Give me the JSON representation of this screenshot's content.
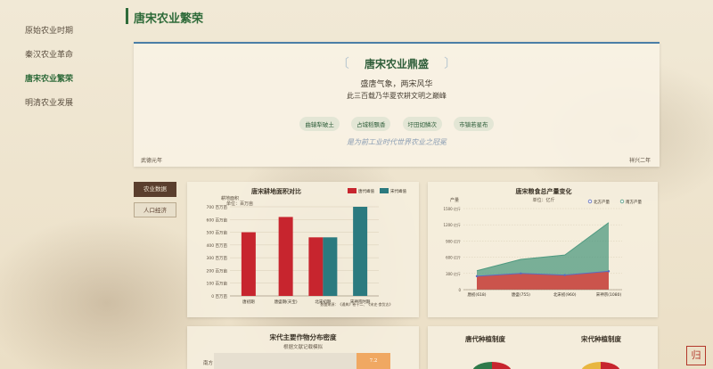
{
  "sidebar": {
    "items": [
      {
        "label": "原始农业时期"
      },
      {
        "label": "秦汉农业革命"
      },
      {
        "label": "唐宋农业繁荣"
      },
      {
        "label": "明清农业发展"
      }
    ]
  },
  "page": {
    "title": "唐宋农业繁荣"
  },
  "hero": {
    "title": "唐宋农业鼎盛",
    "line1": "盛唐气象，两宋风华",
    "line2": "此三百载乃华夏农耕文明之巅峰",
    "tags": [
      "曲辕犁破土",
      "占城稻飘香",
      "圩田如鳞次",
      "市镇若星布"
    ],
    "quote": "是为前工业时代世界农业之冠冕",
    "left_note": "武德元年",
    "right_note": "祥兴二年"
  },
  "buttons": {
    "farm_data": "农业数据",
    "population": "人口经济"
  },
  "seal": {
    "text": "归"
  },
  "chart_data": [
    {
      "type": "bar",
      "title": "唐宋耕地面积对比",
      "ylabel": "耕地面积",
      "unit": "单位：百万亩",
      "categories": [
        "唐初期",
        "唐盛期(天宝)",
        "北宋初期",
        "宋神宗时期"
      ],
      "series": [
        {
          "name": "唐代峰值",
          "values": [
            500,
            620,
            460,
            null
          ],
          "color": "#c7252e"
        },
        {
          "name": "宋代峰值",
          "values": [
            null,
            null,
            460,
            700
          ],
          "color": "#2b7a7f"
        }
      ],
      "ylim": [
        0,
        700
      ],
      "yticks": [
        "0 百万亩",
        "100 百万亩",
        "200 百万亩",
        "300 百万亩",
        "400 百万亩",
        "500 百万亩",
        "600 百万亩",
        "700 百万亩"
      ],
      "source": "数据来源：《通典》卷十二、《宋史·食货志》",
      "legend": "top-right"
    },
    {
      "type": "area",
      "title": "唐宋粮食总产量变化",
      "unit": "单位：亿斤",
      "ylabel": "产量",
      "categories": [
        "唐初(618)",
        "唐盛(755)",
        "北宋初(960)",
        "宋神宗(1080)"
      ],
      "series": [
        {
          "name": "北方产量",
          "values": [
            250,
            300,
            270,
            340
          ],
          "color": "#5a6bc0"
        },
        {
          "name": "南方产量",
          "values": [
            350,
            560,
            640,
            1240
          ],
          "color": "#4f9a80"
        }
      ],
      "ylim": [
        0,
        1500
      ],
      "yticks": [
        "0",
        "300 亿斤",
        "600 亿斤",
        "900 亿斤",
        "1200 亿斤",
        "1500 亿斤"
      ],
      "legend": "top-right"
    }
  ],
  "density_card": {
    "title": "宋代主要作物分布密度",
    "sub": "根据文献记载模拟",
    "row_label": "南方",
    "cell_value": "7.2"
  },
  "tang_card": {
    "title": "唐代种植制度"
  },
  "song_card": {
    "title": "宋代种植制度"
  }
}
